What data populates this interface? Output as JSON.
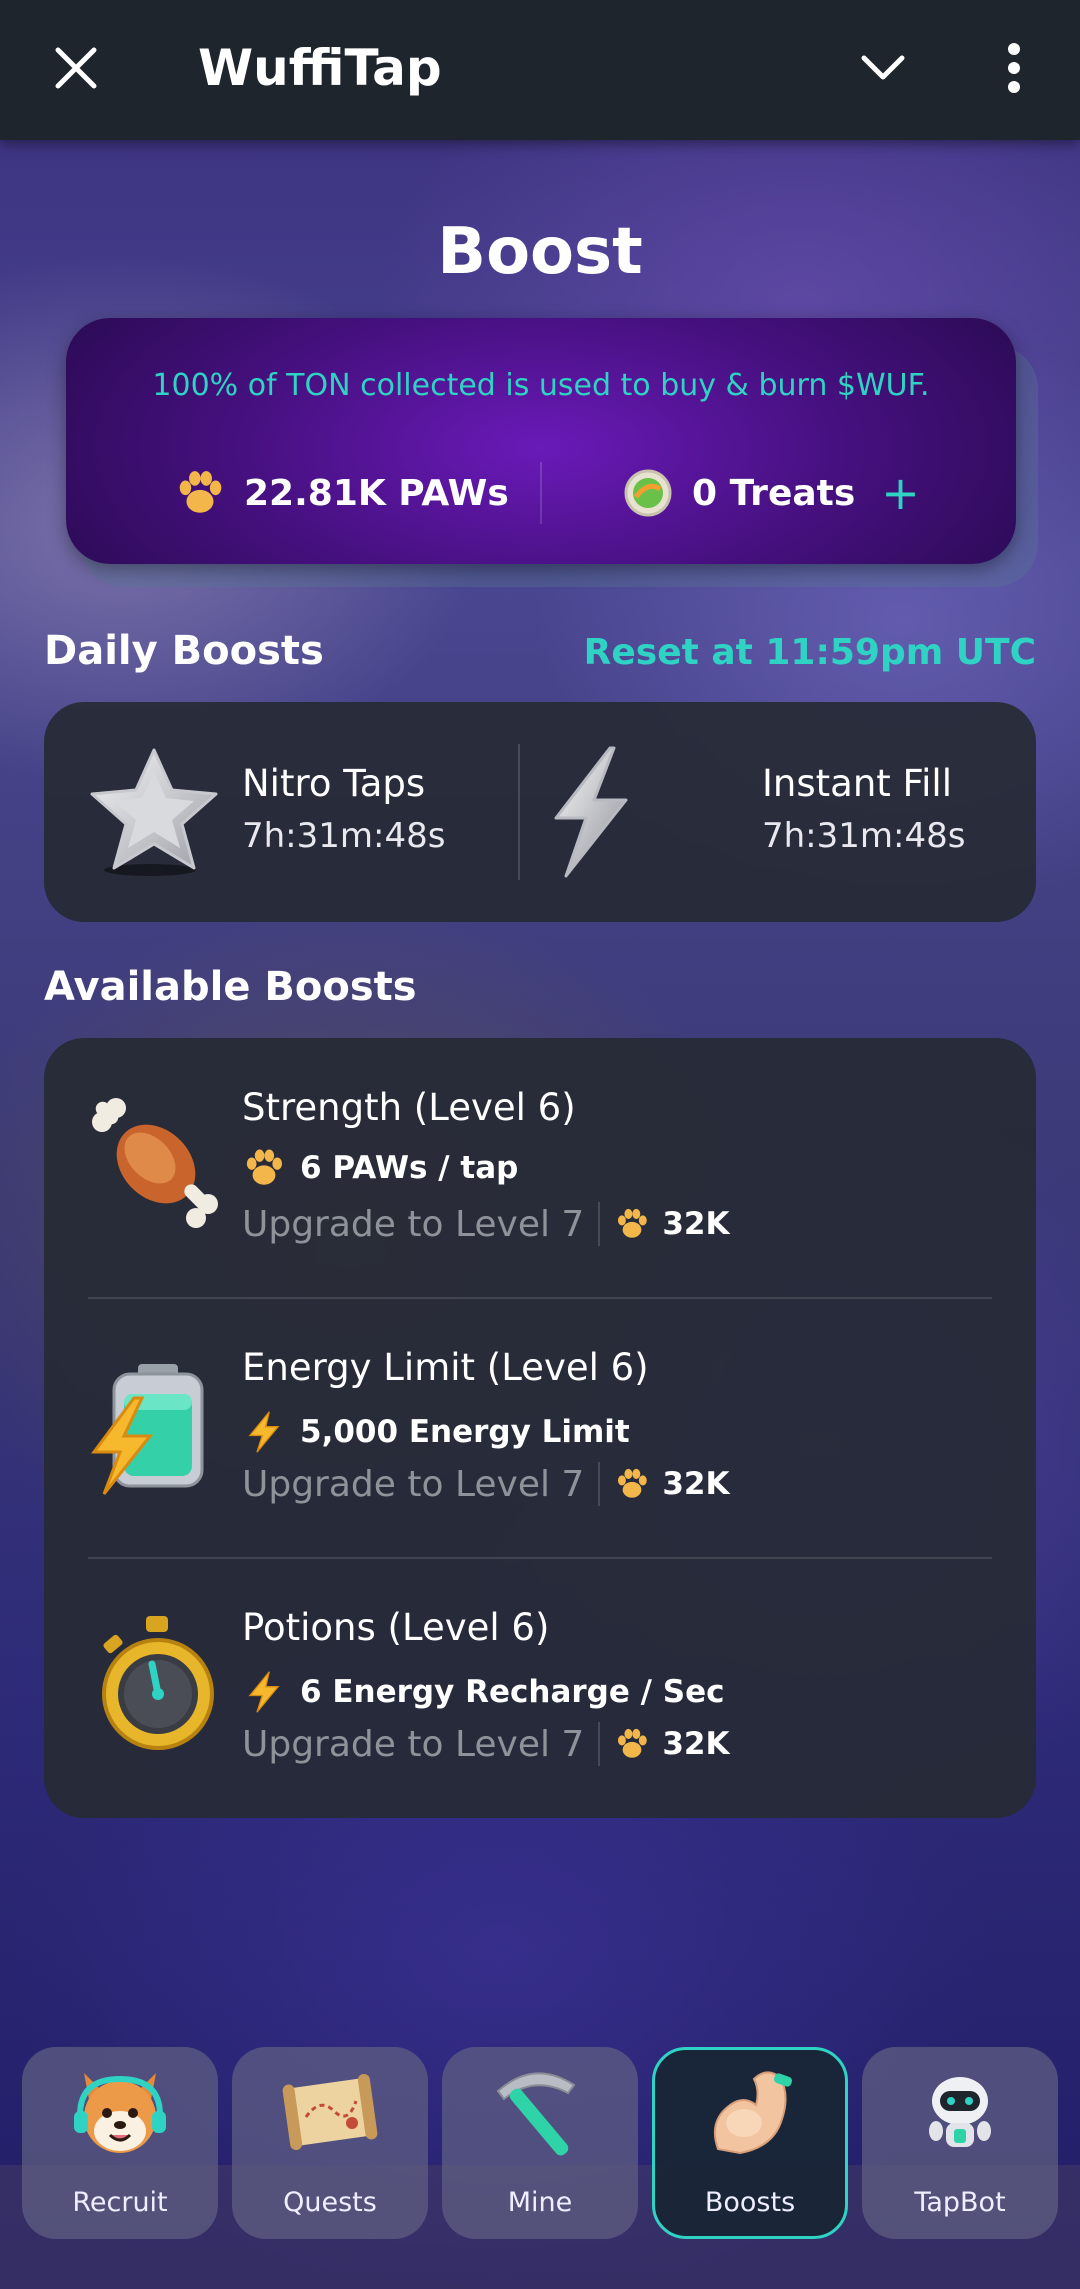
{
  "header": {
    "title": "WuffiTap",
    "close_icon": "close-icon",
    "collapse_icon": "chevron-down-icon",
    "more_icon": "more-vertical-icon"
  },
  "page": {
    "title": "Boost"
  },
  "burn_card": {
    "text": "100% of TON collected is used to buy & burn $WUF.",
    "paws_balance": "22.81K PAWs",
    "treats_balance": "0 Treats",
    "add_label": "+"
  },
  "daily": {
    "title": "Daily Boosts",
    "reset": "Reset at 11:59pm UTC",
    "items": [
      {
        "name": "Nitro Taps",
        "timer": "7h:31m:48s",
        "icon": "star-icon"
      },
      {
        "name": "Instant Fill",
        "timer": "7h:31m:48s",
        "icon": "lightning-icon"
      }
    ]
  },
  "available": {
    "title": "Available Boosts",
    "items": [
      {
        "name": "Strength (Level 6)",
        "effect": "6 PAWs / tap",
        "effect_icon": "paw-icon",
        "upgrade": "Upgrade to Level 7",
        "cost": "32K",
        "icon": "meat-bone-icon"
      },
      {
        "name": "Energy Limit (Level 6)",
        "effect": "5,000 Energy Limit",
        "effect_icon": "lightning-icon",
        "upgrade": "Upgrade to Level 7",
        "cost": "32K",
        "icon": "battery-icon"
      },
      {
        "name": "Potions (Level 6)",
        "effect": "6 Energy Recharge / Sec",
        "effect_icon": "lightning-icon",
        "upgrade": "Upgrade to Level 7",
        "cost": "32K",
        "icon": "stopwatch-icon"
      }
    ]
  },
  "nav": {
    "active": "Boosts",
    "items": [
      {
        "label": "Recruit",
        "icon": "shiba-dog-icon"
      },
      {
        "label": "Quests",
        "icon": "map-scroll-icon"
      },
      {
        "label": "Mine",
        "icon": "pickaxe-icon"
      },
      {
        "label": "Boosts",
        "icon": "flexed-arm-icon"
      },
      {
        "label": "TapBot",
        "icon": "robot-icon"
      }
    ]
  },
  "colors": {
    "accent": "#2fd3c4",
    "topbar": "#1f252d",
    "card": "#262a34",
    "muted_text": "#8e9299",
    "paw": "#f3b64a"
  }
}
